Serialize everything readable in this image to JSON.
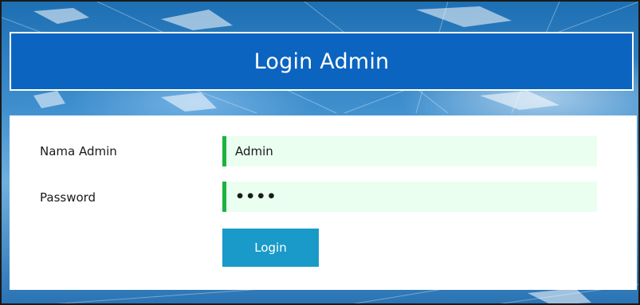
{
  "header": {
    "title": "Login Admin"
  },
  "form": {
    "username": {
      "label": "Nama Admin",
      "value": "Admin"
    },
    "password": {
      "label": "Password",
      "value_masked": "••••"
    },
    "submit_label": "Login"
  },
  "colors": {
    "header_bg": "#0b64c0",
    "field_bg": "#eafff0",
    "field_accent": "#19b340",
    "button_bg": "#1a9ac8"
  }
}
